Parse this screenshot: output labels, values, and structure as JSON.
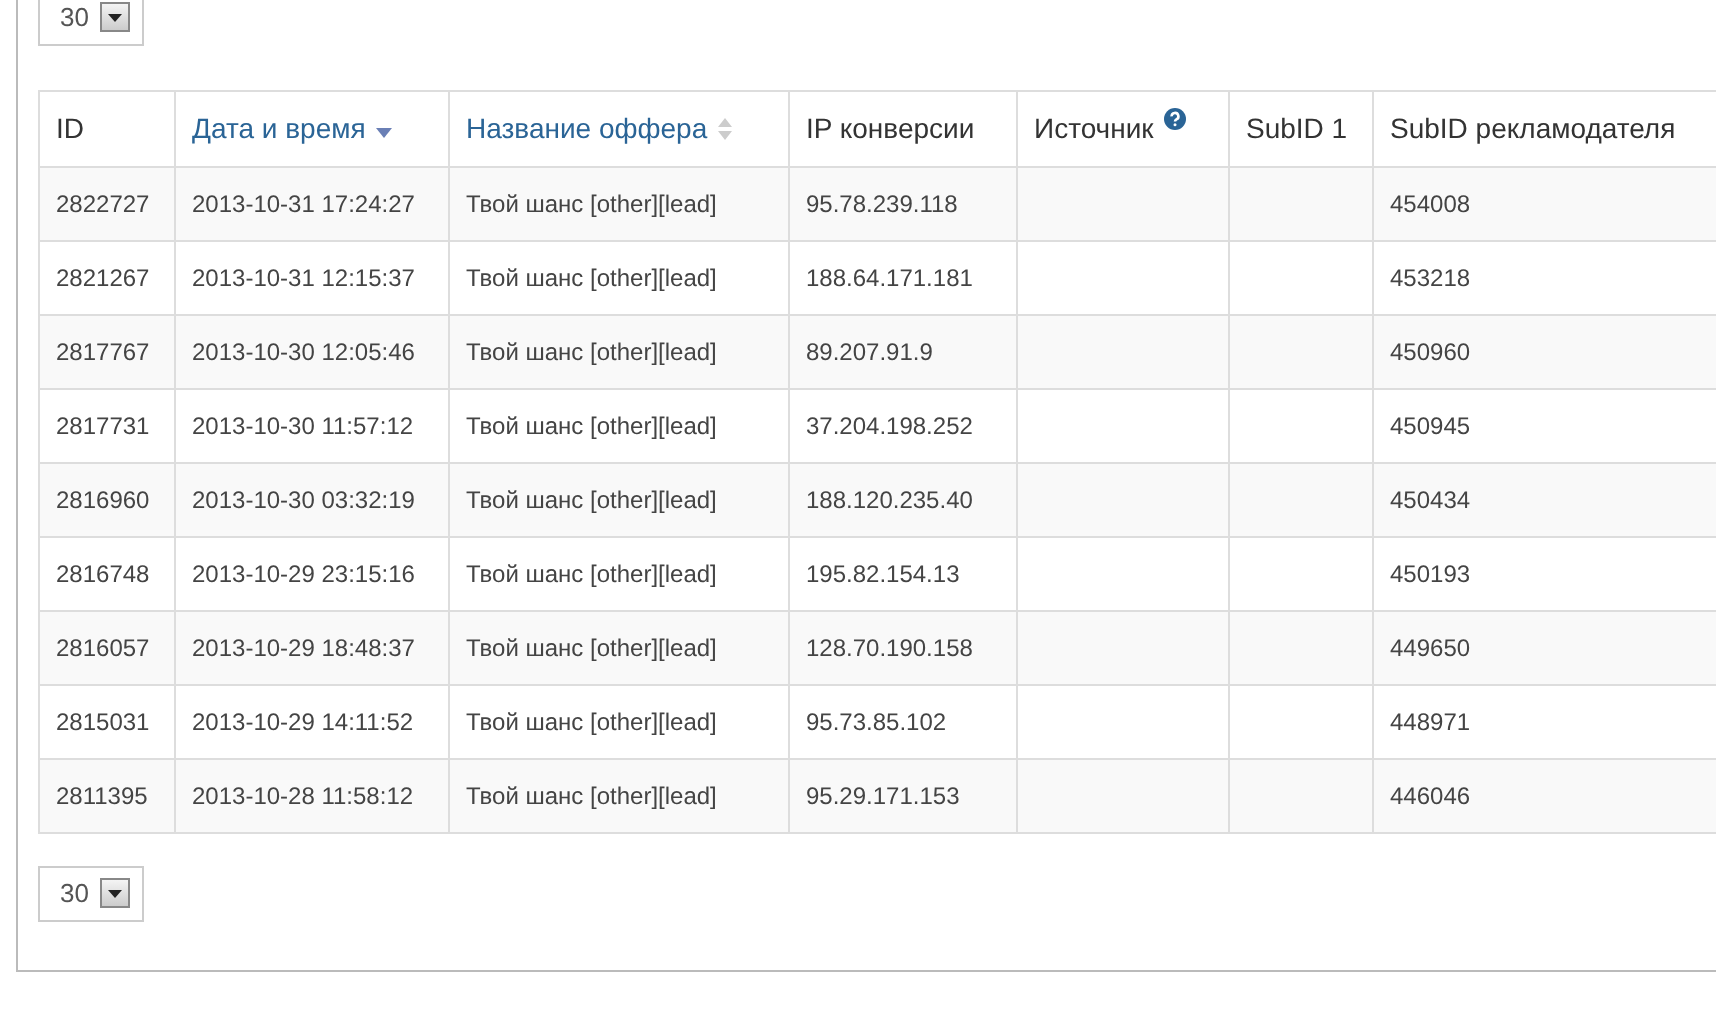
{
  "page_size_top": {
    "value": "30"
  },
  "table": {
    "columns": [
      {
        "label": "ID",
        "kind": "plain"
      },
      {
        "label": "Дата и время",
        "kind": "sortable",
        "sorted": true
      },
      {
        "label": "Название оффера",
        "kind": "sortable",
        "sorted": false
      },
      {
        "label": "IP конверсии",
        "kind": "plain"
      },
      {
        "label": "Источник",
        "kind": "help"
      },
      {
        "label": "SubID 1",
        "kind": "plain"
      },
      {
        "label": "SubID рекламодателя",
        "kind": "plain"
      }
    ],
    "rows": [
      [
        "2822727",
        "2013-10-31 17:24:27",
        "Твой шанс [other][lead]",
        "95.78.239.118",
        "",
        "",
        "454008"
      ],
      [
        "2821267",
        "2013-10-31 12:15:37",
        "Твой шанс [other][lead]",
        "188.64.171.181",
        "",
        "",
        "453218"
      ],
      [
        "2817767",
        "2013-10-30 12:05:46",
        "Твой шанс [other][lead]",
        "89.207.91.9",
        "",
        "",
        "450960"
      ],
      [
        "2817731",
        "2013-10-30 11:57:12",
        "Твой шанс [other][lead]",
        "37.204.198.252",
        "",
        "",
        "450945"
      ],
      [
        "2816960",
        "2013-10-30 03:32:19",
        "Твой шанс [other][lead]",
        "188.120.235.40",
        "",
        "",
        "450434"
      ],
      [
        "2816748",
        "2013-10-29 23:15:16",
        "Твой шанс [other][lead]",
        "195.82.154.13",
        "",
        "",
        "450193"
      ],
      [
        "2816057",
        "2013-10-29 18:48:37",
        "Твой шанс [other][lead]",
        "128.70.190.158",
        "",
        "",
        "449650"
      ],
      [
        "2815031",
        "2013-10-29 14:11:52",
        "Твой шанс [other][lead]",
        "95.73.85.102",
        "",
        "",
        "448971"
      ],
      [
        "2811395",
        "2013-10-28 11:58:12",
        "Твой шанс [other][lead]",
        "95.29.171.153",
        "",
        "",
        "446046"
      ]
    ]
  },
  "page_size_bottom": {
    "value": "30"
  }
}
